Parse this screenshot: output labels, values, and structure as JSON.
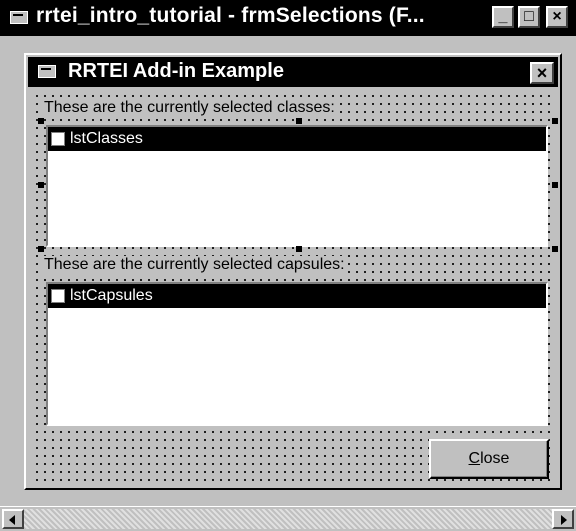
{
  "outer_window": {
    "title": "rrtei_intro_tutorial - frmSelections (F...",
    "buttons": {
      "minimize": "_",
      "maximize": "□",
      "close": "×"
    }
  },
  "form": {
    "title": "RRTEI Add-in Example",
    "close_glyph": "×",
    "classes_label": "These are the currently selected classes:",
    "classes_list": {
      "items": [
        "lstClasses"
      ]
    },
    "capsules_label": "These are the currently selected capsules:",
    "capsules_list": {
      "items": [
        "lstCapsules"
      ]
    },
    "close_button": {
      "mnemonic": "C",
      "rest": "lose"
    }
  },
  "icons": {
    "outer_system": "window-icon",
    "form_system": "window-icon"
  },
  "colors": {
    "titlebar": "#000000",
    "face": "#c0c0c0",
    "selection": "#000000"
  }
}
